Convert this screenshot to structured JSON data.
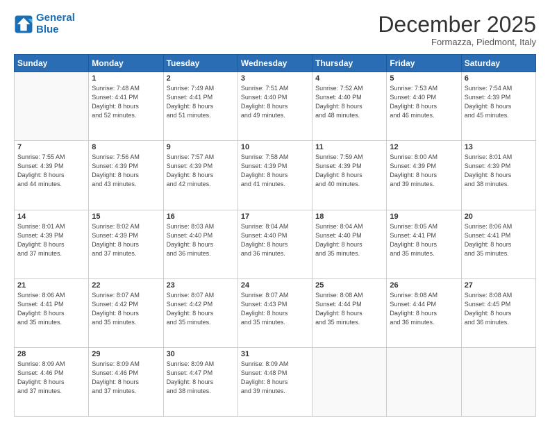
{
  "header": {
    "logo_line1": "General",
    "logo_line2": "Blue",
    "month": "December 2025",
    "location": "Formazza, Piedmont, Italy"
  },
  "weekdays": [
    "Sunday",
    "Monday",
    "Tuesday",
    "Wednesday",
    "Thursday",
    "Friday",
    "Saturday"
  ],
  "weeks": [
    [
      {
        "day": "",
        "info": ""
      },
      {
        "day": "1",
        "info": "Sunrise: 7:48 AM\nSunset: 4:41 PM\nDaylight: 8 hours\nand 52 minutes."
      },
      {
        "day": "2",
        "info": "Sunrise: 7:49 AM\nSunset: 4:41 PM\nDaylight: 8 hours\nand 51 minutes."
      },
      {
        "day": "3",
        "info": "Sunrise: 7:51 AM\nSunset: 4:40 PM\nDaylight: 8 hours\nand 49 minutes."
      },
      {
        "day": "4",
        "info": "Sunrise: 7:52 AM\nSunset: 4:40 PM\nDaylight: 8 hours\nand 48 minutes."
      },
      {
        "day": "5",
        "info": "Sunrise: 7:53 AM\nSunset: 4:40 PM\nDaylight: 8 hours\nand 46 minutes."
      },
      {
        "day": "6",
        "info": "Sunrise: 7:54 AM\nSunset: 4:39 PM\nDaylight: 8 hours\nand 45 minutes."
      }
    ],
    [
      {
        "day": "7",
        "info": "Sunrise: 7:55 AM\nSunset: 4:39 PM\nDaylight: 8 hours\nand 44 minutes."
      },
      {
        "day": "8",
        "info": "Sunrise: 7:56 AM\nSunset: 4:39 PM\nDaylight: 8 hours\nand 43 minutes."
      },
      {
        "day": "9",
        "info": "Sunrise: 7:57 AM\nSunset: 4:39 PM\nDaylight: 8 hours\nand 42 minutes."
      },
      {
        "day": "10",
        "info": "Sunrise: 7:58 AM\nSunset: 4:39 PM\nDaylight: 8 hours\nand 41 minutes."
      },
      {
        "day": "11",
        "info": "Sunrise: 7:59 AM\nSunset: 4:39 PM\nDaylight: 8 hours\nand 40 minutes."
      },
      {
        "day": "12",
        "info": "Sunrise: 8:00 AM\nSunset: 4:39 PM\nDaylight: 8 hours\nand 39 minutes."
      },
      {
        "day": "13",
        "info": "Sunrise: 8:01 AM\nSunset: 4:39 PM\nDaylight: 8 hours\nand 38 minutes."
      }
    ],
    [
      {
        "day": "14",
        "info": "Sunrise: 8:01 AM\nSunset: 4:39 PM\nDaylight: 8 hours\nand 37 minutes."
      },
      {
        "day": "15",
        "info": "Sunrise: 8:02 AM\nSunset: 4:39 PM\nDaylight: 8 hours\nand 37 minutes."
      },
      {
        "day": "16",
        "info": "Sunrise: 8:03 AM\nSunset: 4:40 PM\nDaylight: 8 hours\nand 36 minutes."
      },
      {
        "day": "17",
        "info": "Sunrise: 8:04 AM\nSunset: 4:40 PM\nDaylight: 8 hours\nand 36 minutes."
      },
      {
        "day": "18",
        "info": "Sunrise: 8:04 AM\nSunset: 4:40 PM\nDaylight: 8 hours\nand 35 minutes."
      },
      {
        "day": "19",
        "info": "Sunrise: 8:05 AM\nSunset: 4:41 PM\nDaylight: 8 hours\nand 35 minutes."
      },
      {
        "day": "20",
        "info": "Sunrise: 8:06 AM\nSunset: 4:41 PM\nDaylight: 8 hours\nand 35 minutes."
      }
    ],
    [
      {
        "day": "21",
        "info": "Sunrise: 8:06 AM\nSunset: 4:41 PM\nDaylight: 8 hours\nand 35 minutes."
      },
      {
        "day": "22",
        "info": "Sunrise: 8:07 AM\nSunset: 4:42 PM\nDaylight: 8 hours\nand 35 minutes."
      },
      {
        "day": "23",
        "info": "Sunrise: 8:07 AM\nSunset: 4:42 PM\nDaylight: 8 hours\nand 35 minutes."
      },
      {
        "day": "24",
        "info": "Sunrise: 8:07 AM\nSunset: 4:43 PM\nDaylight: 8 hours\nand 35 minutes."
      },
      {
        "day": "25",
        "info": "Sunrise: 8:08 AM\nSunset: 4:44 PM\nDaylight: 8 hours\nand 35 minutes."
      },
      {
        "day": "26",
        "info": "Sunrise: 8:08 AM\nSunset: 4:44 PM\nDaylight: 8 hours\nand 36 minutes."
      },
      {
        "day": "27",
        "info": "Sunrise: 8:08 AM\nSunset: 4:45 PM\nDaylight: 8 hours\nand 36 minutes."
      }
    ],
    [
      {
        "day": "28",
        "info": "Sunrise: 8:09 AM\nSunset: 4:46 PM\nDaylight: 8 hours\nand 37 minutes."
      },
      {
        "day": "29",
        "info": "Sunrise: 8:09 AM\nSunset: 4:46 PM\nDaylight: 8 hours\nand 37 minutes."
      },
      {
        "day": "30",
        "info": "Sunrise: 8:09 AM\nSunset: 4:47 PM\nDaylight: 8 hours\nand 38 minutes."
      },
      {
        "day": "31",
        "info": "Sunrise: 8:09 AM\nSunset: 4:48 PM\nDaylight: 8 hours\nand 39 minutes."
      },
      {
        "day": "",
        "info": ""
      },
      {
        "day": "",
        "info": ""
      },
      {
        "day": "",
        "info": ""
      }
    ]
  ]
}
